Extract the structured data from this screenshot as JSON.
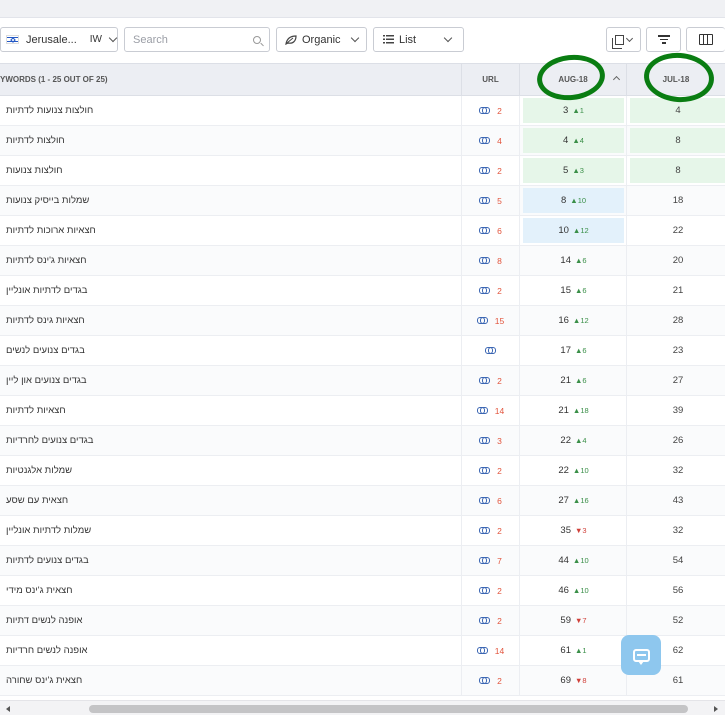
{
  "toolbar": {
    "location_label": "Jerusale...",
    "language": "IW",
    "search_placeholder": "Search",
    "search_value": "",
    "organic_label": "Organic",
    "view_label": "List"
  },
  "table": {
    "header": {
      "keywords_label": "YWORDS (1 - 25 OUT OF 25)",
      "url_label": "URL",
      "aug_label": "AUG-18",
      "jul_label": "JUL-18"
    },
    "rows": [
      {
        "keyword": "חולצות צנועות לדתיות",
        "url_count": "2",
        "aug": "3",
        "change": "1",
        "dir": "up",
        "jul": "4",
        "aug_color": "green",
        "jul_color": "green"
      },
      {
        "keyword": "חולצות לדתיות",
        "url_count": "4",
        "aug": "4",
        "change": "4",
        "dir": "up",
        "jul": "8",
        "aug_color": "green",
        "jul_color": "green"
      },
      {
        "keyword": "חולצות צנועות",
        "url_count": "2",
        "aug": "5",
        "change": "3",
        "dir": "up",
        "jul": "8",
        "aug_color": "green",
        "jul_color": "green"
      },
      {
        "keyword": "שמלות בייסיק צנועות",
        "url_count": "5",
        "aug": "8",
        "change": "10",
        "dir": "up",
        "jul": "18",
        "aug_color": "blue",
        "jul_color": ""
      },
      {
        "keyword": "חצאיות ארוכות לדתיות",
        "url_count": "6",
        "aug": "10",
        "change": "12",
        "dir": "up",
        "jul": "22",
        "aug_color": "blue",
        "jul_color": ""
      },
      {
        "keyword": "חצאיות ג'ינס לדתיות",
        "url_count": "8",
        "aug": "14",
        "change": "6",
        "dir": "up",
        "jul": "20",
        "aug_color": "",
        "jul_color": ""
      },
      {
        "keyword": "בגדים לדתיות אונליין",
        "url_count": "2",
        "aug": "15",
        "change": "6",
        "dir": "up",
        "jul": "21",
        "aug_color": "",
        "jul_color": ""
      },
      {
        "keyword": "חצאיות גינס לדתיות",
        "url_count": "15",
        "aug": "16",
        "change": "12",
        "dir": "up",
        "jul": "28",
        "aug_color": "",
        "jul_color": ""
      },
      {
        "keyword": "בגדים צנועים לנשים",
        "url_count": "",
        "aug": "17",
        "change": "6",
        "dir": "up",
        "jul": "23",
        "aug_color": "",
        "jul_color": ""
      },
      {
        "keyword": "בגדים צנועים און ליין",
        "url_count": "2",
        "aug": "21",
        "change": "6",
        "dir": "up",
        "jul": "27",
        "aug_color": "",
        "jul_color": ""
      },
      {
        "keyword": "חצאיות לדתיות",
        "url_count": "14",
        "aug": "21",
        "change": "18",
        "dir": "up",
        "jul": "39",
        "aug_color": "",
        "jul_color": ""
      },
      {
        "keyword": "בגדים צנועים לחרדיות",
        "url_count": "3",
        "aug": "22",
        "change": "4",
        "dir": "up",
        "jul": "26",
        "aug_color": "",
        "jul_color": ""
      },
      {
        "keyword": "שמלות אלגנטיות",
        "url_count": "2",
        "aug": "22",
        "change": "10",
        "dir": "up",
        "jul": "32",
        "aug_color": "",
        "jul_color": ""
      },
      {
        "keyword": "חצאית עם שסע",
        "url_count": "6",
        "aug": "27",
        "change": "16",
        "dir": "up",
        "jul": "43",
        "aug_color": "",
        "jul_color": ""
      },
      {
        "keyword": "שמלות לדתיות אונליין",
        "url_count": "2",
        "aug": "35",
        "change": "3",
        "dir": "down",
        "jul": "32",
        "aug_color": "",
        "jul_color": ""
      },
      {
        "keyword": "בגדים צנועים לדתיות",
        "url_count": "7",
        "aug": "44",
        "change": "10",
        "dir": "up",
        "jul": "54",
        "aug_color": "",
        "jul_color": ""
      },
      {
        "keyword": "חצאית ג'ינס מידי",
        "url_count": "2",
        "aug": "46",
        "change": "10",
        "dir": "up",
        "jul": "56",
        "aug_color": "",
        "jul_color": ""
      },
      {
        "keyword": "אופנה לנשים דתיות",
        "url_count": "2",
        "aug": "59",
        "change": "7",
        "dir": "down",
        "jul": "52",
        "aug_color": "",
        "jul_color": ""
      },
      {
        "keyword": "אופנה לנשים חרדיות",
        "url_count": "14",
        "aug": "61",
        "change": "1",
        "dir": "up",
        "jul": "62",
        "aug_color": "",
        "jul_color": ""
      },
      {
        "keyword": "חצאית ג'ינס שחורה",
        "url_count": "2",
        "aug": "69",
        "change": "8",
        "dir": "down",
        "jul": "61",
        "aug_color": "",
        "jul_color": ""
      }
    ]
  },
  "colors": {
    "accent_green_bg": "#e6f6e9",
    "accent_blue_bg": "#e3f1fb",
    "up": "#3a8f48",
    "down": "#d0413a",
    "annotation_circle": "#0a7d12"
  },
  "icons": {
    "flag": "israel-flag-icon",
    "search": "search-icon",
    "organic": "organic-leaf-icon",
    "list": "list-icon",
    "copy": "copy-icon",
    "filter": "filter-icon",
    "columns": "columns-icon",
    "link": "link-icon",
    "chat": "chat-icon"
  }
}
